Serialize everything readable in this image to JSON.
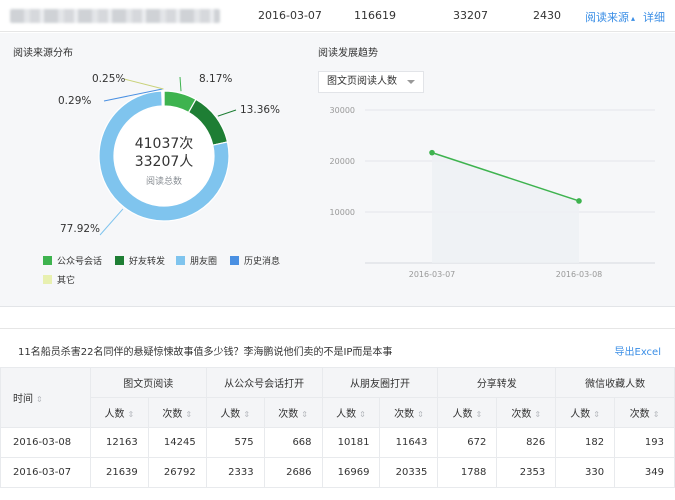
{
  "top_row": {
    "date": "2016-03-07",
    "v1": "116619",
    "v2": "33207",
    "v3": "2430",
    "source_link": "阅读来源",
    "detail_link": "详细"
  },
  "donut": {
    "title": "阅读来源分布",
    "total_reads": "41037次",
    "total_people": "33207人",
    "center_caption": "阅读总数",
    "slices": [
      {
        "name": "公众号会话",
        "pct": 8.17,
        "label": "8.17%",
        "color": "#3eb34f"
      },
      {
        "name": "好友转发",
        "pct": 13.36,
        "label": "13.36%",
        "color": "#1e7e34"
      },
      {
        "name": "朋友圈",
        "pct": 77.92,
        "label": "77.92%",
        "color": "#7fc4ee"
      },
      {
        "name": "历史消息",
        "pct": 0.29,
        "label": "0.29%",
        "color": "#4a90e2"
      },
      {
        "name": "其它",
        "pct": 0.25,
        "label": "0.25%",
        "color": "#e8f0b0"
      }
    ]
  },
  "trend": {
    "title": "阅读发展趋势",
    "dropdown_value": "图文页阅读人数"
  },
  "chart_data": {
    "type": "line",
    "x": [
      "2016-03-07",
      "2016-03-08"
    ],
    "series": [
      {
        "values": [
          21639,
          12163
        ],
        "color": "#3eb34f"
      }
    ],
    "yticks": [
      "30000",
      "20000",
      "10000"
    ],
    "ylim": [
      0,
      30000
    ],
    "grid": true
  },
  "table": {
    "article_title": "11名船员杀害22名同伴的悬疑惊悚故事值多少钱？李海鹏说他们卖的不是IP而是本事",
    "export_label": "导出Excel",
    "time_header": "时间",
    "group_headers": [
      "图文页阅读",
      "从公众号会话打开",
      "从朋友圈打开",
      "分享转发",
      "微信收藏人数"
    ],
    "sub_people": "人数",
    "sub_times": "次数",
    "rows": [
      {
        "date": "2016-03-08",
        "cells": [
          "12163",
          "14245",
          "575",
          "668",
          "10181",
          "11643",
          "672",
          "826",
          "182",
          "193"
        ]
      },
      {
        "date": "2016-03-07",
        "cells": [
          "21639",
          "26792",
          "2333",
          "2686",
          "16969",
          "20335",
          "1788",
          "2353",
          "330",
          "349"
        ]
      }
    ]
  }
}
